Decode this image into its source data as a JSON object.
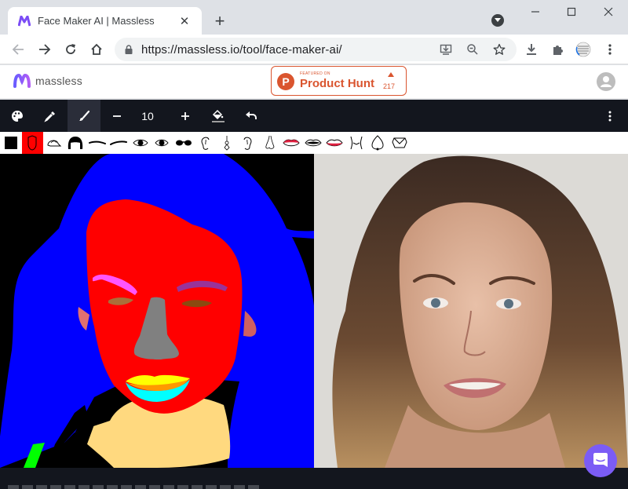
{
  "browser": {
    "tab_title": "Face Maker AI | Massless",
    "url": "https://massless.io/tool/face-maker-ai/",
    "new_tab_symbol": "+",
    "close_symbol": "✕"
  },
  "site": {
    "logo_text": "massless",
    "product_hunt": {
      "featured_label": "FEATURED ON",
      "name": "Product Hunt",
      "letter": "P",
      "upvotes": "217"
    }
  },
  "app_toolbar": {
    "tools": [
      {
        "name": "palette",
        "icon": "palette-icon",
        "active": false
      },
      {
        "name": "eyedropper",
        "icon": "eyedropper-icon",
        "active": false
      },
      {
        "name": "brush",
        "icon": "brush-icon",
        "active": true
      }
    ],
    "brush_size": "10",
    "decrease_symbol": "−",
    "increase_symbol": "+"
  },
  "face_parts": [
    {
      "name": "background",
      "color": "#000000"
    },
    {
      "name": "skin",
      "color": "#ff0000",
      "selected": true
    },
    {
      "name": "hat"
    },
    {
      "name": "hair"
    },
    {
      "name": "left-eyebrow"
    },
    {
      "name": "right-eyebrow"
    },
    {
      "name": "left-eye"
    },
    {
      "name": "right-eye"
    },
    {
      "name": "eyeglasses"
    },
    {
      "name": "left-ear"
    },
    {
      "name": "earring"
    },
    {
      "name": "right-ear"
    },
    {
      "name": "nose"
    },
    {
      "name": "upper-lip"
    },
    {
      "name": "mouth"
    },
    {
      "name": "lower-lip"
    },
    {
      "name": "neck"
    },
    {
      "name": "necklace"
    },
    {
      "name": "cloth"
    }
  ],
  "colors": {
    "accent": "#7b5cf5",
    "product_hunt": "#da552f",
    "toolbar_bg": "#13161e",
    "seg_hair": "#0000ff",
    "seg_skin": "#ff0000",
    "seg_neck": "#ffd97f",
    "seg_nose": "#808080",
    "seg_upper_lip": "#ffff00",
    "seg_mouth": "#ff9900",
    "seg_lower_lip": "#00ffff",
    "seg_left_brow": "#ff55ff",
    "seg_right_brow": "#993399",
    "seg_cloth": "#00ff00"
  }
}
